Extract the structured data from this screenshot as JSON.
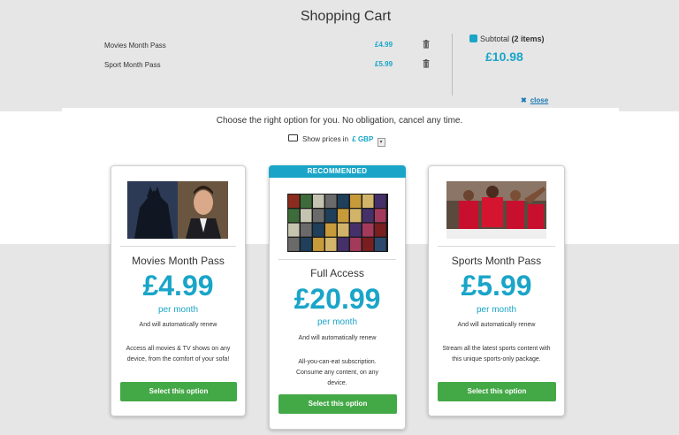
{
  "cart": {
    "title": "Shopping Cart",
    "items": [
      {
        "name": "Movies Month Pass",
        "price": "£4.99"
      },
      {
        "name": "Sport Month Pass",
        "price": "£5.99"
      }
    ],
    "subtotal_label": "Subtotal",
    "subtotal_count": "(2 items)",
    "subtotal_value": "£10.98",
    "close_label": "close"
  },
  "intro": {
    "tagline": "Choose the right option for you. No obligation, cancel any time.",
    "currency_prefix": "Show prices in",
    "currency_value": "£ GBP"
  },
  "plans": [
    {
      "title": "Movies Month Pass",
      "price": "£4.99",
      "period": "per month",
      "renew": "And will automatically renew",
      "description": "Access all movies & TV shows on any device, from the comfort of your sofa!",
      "button": "Select this option"
    },
    {
      "badge": "RECOMMENDED",
      "title": "Full Access",
      "price": "£20.99",
      "period": "per month",
      "renew": "And will automatically renew",
      "description": "All-you-can-eat subscription. Consume any content, on any device.",
      "button": "Select this option"
    },
    {
      "title": "Sports Month Pass",
      "price": "£5.99",
      "period": "per month",
      "renew": "And will automatically renew",
      "description": "Stream all the latest sports content with this unique sports-only package.",
      "button": "Select this option"
    }
  ],
  "colors": {
    "accent": "#1aa5c8",
    "button": "#43a846",
    "panel": "#e6e6e6"
  }
}
